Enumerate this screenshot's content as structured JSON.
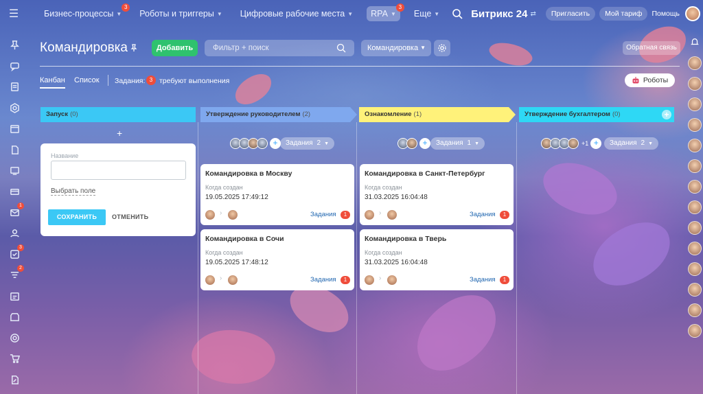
{
  "colors": {
    "accent_green": "#2fc26e",
    "badge_red": "#ef4d3b",
    "stage_launch": "#3bc8f5",
    "stage_manager": "#7fa8ee",
    "stage_familiarize": "#fff27a",
    "stage_accountant": "#2ed8f5"
  },
  "topbar": {
    "nav": [
      {
        "label": "Бизнес-процессы",
        "badge": "3"
      },
      {
        "label": "Роботы и триггеры",
        "badge": ""
      },
      {
        "label": "Цифровые рабочие места",
        "badge": ""
      },
      {
        "label": "RPA",
        "badge": "3"
      },
      {
        "label": "Еще",
        "badge": ""
      }
    ],
    "logo": "Битрикс",
    "logo_num": "24",
    "invite": "Пригласить",
    "tariff": "Мой тариф",
    "help": "Помощь"
  },
  "sidebar": {
    "badges": {
      "mail": "1",
      "tasks": "3",
      "feed": "2"
    }
  },
  "header": {
    "title": "Командировка",
    "add_button": "Добавить",
    "filter_placeholder": "Фильтр + поиск",
    "select_value": "Командировка",
    "feedback": "Обратная связь"
  },
  "tabs": {
    "kanban": "Канбан",
    "list": "Список",
    "tasks_label": "Задания:",
    "tasks_count": "3",
    "tasks_suffix": "требуют выполнения",
    "robots": "Роботы"
  },
  "columns": [
    {
      "name": "Запуск",
      "count": "(0)"
    },
    {
      "name": "Утверждение руководителем",
      "count": "(2)",
      "tasks_label": "Задания",
      "tasks_count": "2"
    },
    {
      "name": "Ознакомление",
      "count": "(1)",
      "tasks_label": "Задания",
      "tasks_count": "1"
    },
    {
      "name": "Утверждение бухгалтером",
      "count": "(0)",
      "tasks_label": "Задания",
      "tasks_count": "2",
      "more": "+1"
    }
  ],
  "quick_form": {
    "label": "Название",
    "choose_field": "Выбрать поле",
    "save": "СОХРАНИТЬ",
    "cancel": "ОТМЕНИТЬ"
  },
  "cards": [
    {
      "title": "Командировка в Москву",
      "created_label": "Когда создан",
      "date": "19.05.2025 17:49:12",
      "tasks": "Задания",
      "badge": "1"
    },
    {
      "title": "Командировка в Сочи",
      "created_label": "Когда создан",
      "date": "19.05.2025 17:48:12",
      "tasks": "Задания",
      "badge": "1"
    },
    {
      "title": "Командировка в Санкт-Петербург",
      "created_label": "Когда создан",
      "date": "31.03.2025 16:04:48",
      "tasks": "Задания",
      "badge": "1"
    },
    {
      "title": "Командировка в Тверь",
      "created_label": "Когда создан",
      "date": "31.03.2025 16:04:48",
      "tasks": "Задания",
      "badge": "1"
    }
  ]
}
